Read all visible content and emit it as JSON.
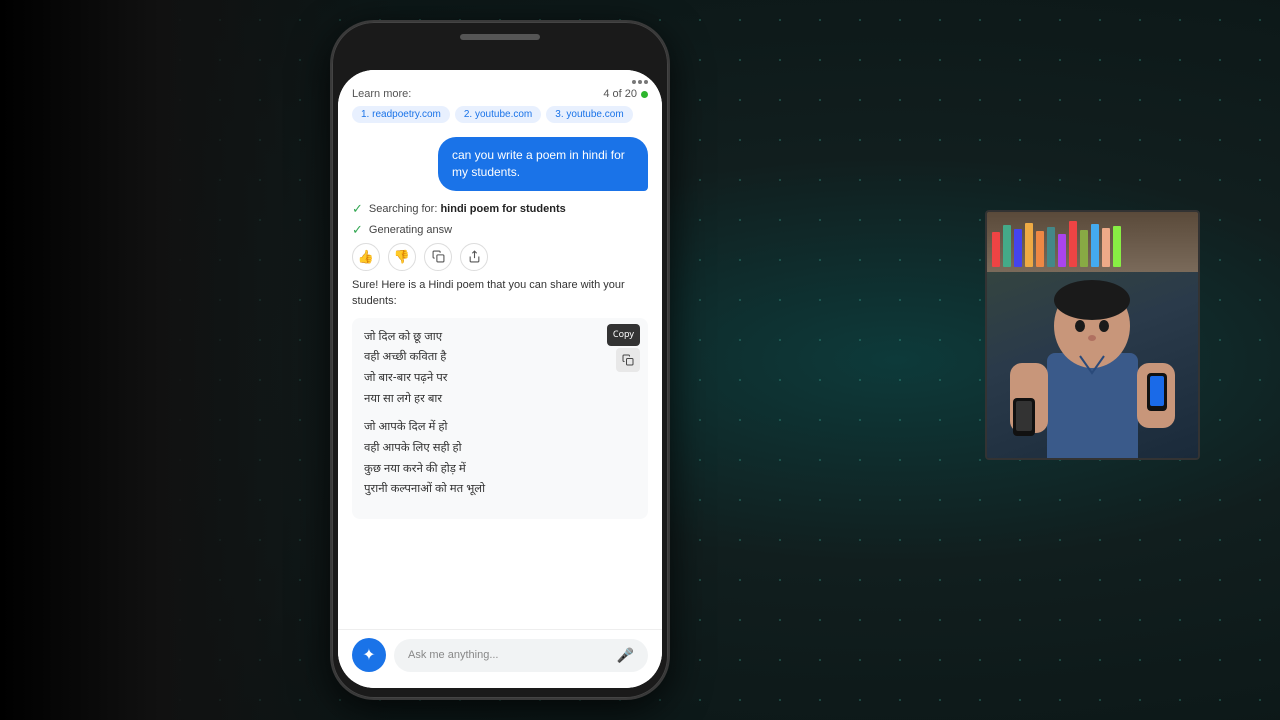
{
  "background": {
    "color": "#1a2a2a"
  },
  "phone": {
    "top_bar": {
      "more_options_label": "More options"
    },
    "learn_more": {
      "label": "Learn more:",
      "page_counter": "4 of 20",
      "links": [
        {
          "number": "1.",
          "url": "readpoetry.com"
        },
        {
          "number": "2.",
          "url": "youtube.com"
        },
        {
          "number": "3.",
          "url": "youtube.com"
        }
      ]
    },
    "user_message": "can you write a poem in hindi for my students.",
    "search_status": {
      "text1": "Searching for:",
      "query": "hindi poem for students",
      "text2": "Generating answ"
    },
    "response": {
      "intro": "Sure! Here is a Hindi poem that you can share with your students:",
      "poem_stanza1": [
        "जो दिल को छू जाए",
        "वही अच्छी कविता है",
        "जो बार-बार पढ़ने पर",
        "नया सा लगे हर बार"
      ],
      "poem_stanza2": [
        "जो आपके दिल में हो",
        "वही आपके लिए सही हो",
        "कुछ नया करने की होड़ में",
        "पुरानी कल्पनाओं को मत भूलो"
      ]
    },
    "copy_tooltip": "Copy",
    "actions": {
      "thumbs_up": "👍",
      "thumbs_down": "👎",
      "copy": "⧉",
      "share": "↗"
    },
    "input": {
      "placeholder": "Ask me anything...",
      "assistant_icon": "✦"
    }
  },
  "video": {
    "book_colors": [
      "#e44",
      "#4a8",
      "#44e",
      "#ea4",
      "#e84",
      "#488",
      "#a4e"
    ]
  }
}
